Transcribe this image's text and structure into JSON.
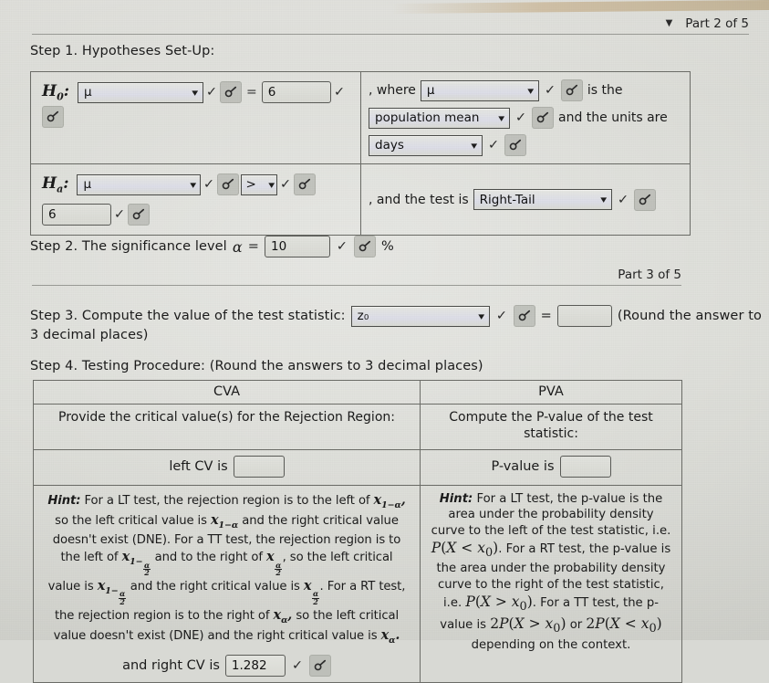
{
  "part2": {
    "label": "Part 2 of 5",
    "caret": "collapse-caret-icon"
  },
  "part3": {
    "label": "Part 3 of 5",
    "caret": ""
  },
  "step1": {
    "heading": "Step 1. Hypotheses Set-Up:",
    "h0": {
      "label": "H",
      "sub": "0",
      "colon": ":",
      "param_select": "μ",
      "operator": "=",
      "value": "6"
    },
    "ha": {
      "label": "H",
      "sub": "a",
      "colon": ":",
      "param_select": "μ",
      "operator_select": ">",
      "value": "6"
    },
    "where": {
      "prefix": ", where",
      "param_select": "μ",
      "mid_text": "is the",
      "meaning_select": "population mean",
      "units_text": "and the units are",
      "units_select": "days"
    },
    "test": {
      "prefix": ", and the test is",
      "tail_select": "Right-Tail"
    }
  },
  "step2": {
    "text_before": "Step 2. The significance level",
    "alpha": "α",
    "equals": "=",
    "value": "10",
    "percent": "%"
  },
  "step3": {
    "text": "Step 3. Compute the value of the test statistic:",
    "statistic_select": "z₀",
    "equals": "=",
    "answer": "",
    "note_line1": "(Round the answer to",
    "note_line2": "3 decimal places)"
  },
  "step4": {
    "heading": "Step 4. Testing Procedure: (Round the answers to 3 decimal places)",
    "headers": [
      "CVA",
      "PVA"
    ],
    "prompts": [
      "Provide the critical value(s) for the Rejection Region:",
      "Compute the P-value of the test statistic:"
    ],
    "cva": {
      "left_cv_label": "left CV is",
      "left_cv_value": "",
      "right_cv_label": "and right CV is",
      "right_cv_value": "1.282",
      "hint_word": "Hint:",
      "hint_p1": "For a LT test, the rejection region is to the left of",
      "hint_p2": "so the left critical value is",
      "hint_p3": "and the right critical value doesn't exist (DNE). For a TT test, the rejection region is to the left of",
      "hint_p4": "and to the right of",
      "hint_p5": ", so the left critical value is",
      "hint_p6": "and the right critical value is",
      "hint_p7": ". For a RT test, the rejection region is to the right of",
      "hint_p8": "so the left critical value doesn't exist (DNE) and the right critical value is",
      "hint_p9": "."
    },
    "pva": {
      "pvalue_label": "P-value is",
      "pvalue_value": "",
      "hint_word": "Hint:",
      "hint_p1": "For a LT test, the p-value is the area under the probability density curve to the left of the test statistic, i.e.",
      "hint_expr1": "P(X < x₀)",
      "hint_p2": ". For a RT test, the p-value is the area under the probability density curve to the right of the test statistic, i.e.",
      "hint_expr2": "P(X > x₀)",
      "hint_p3": ". For a TT test, the p-value is",
      "hint_expr3": "2P(X > x₀)",
      "hint_or": "or",
      "hint_expr4": "2P(X < x₀)",
      "hint_p4": "depending on the context."
    }
  },
  "icons": {
    "key_button": "sigma-key-icon",
    "check": "✓",
    "chevron": "▾"
  },
  "colors": {
    "page_bg": "#d8d9d4",
    "text": "#1b1b1b",
    "border": "#6b6c67",
    "field_border": "#4b4c49",
    "key_button_bg": "#a8aaa3"
  }
}
